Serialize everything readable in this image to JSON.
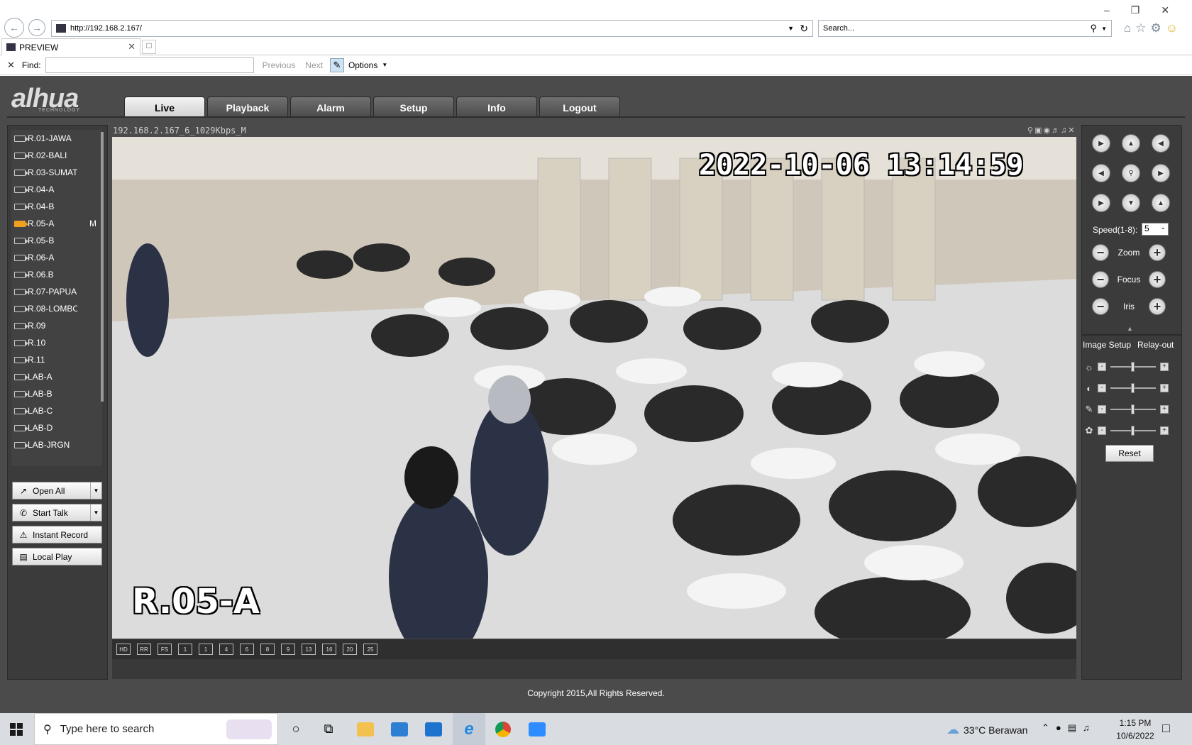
{
  "browser": {
    "url": "http://192.168.2.167/",
    "search_placeholder": "Search...",
    "tab_title": "PREVIEW",
    "find": {
      "label": "Find:",
      "value": "",
      "previous": "Previous",
      "next": "Next",
      "options": "Options"
    }
  },
  "app": {
    "logo": "alhua",
    "logo_sub": "TECHNOLOGY",
    "nav": [
      "Live",
      "Playback",
      "Alarm",
      "Setup",
      "Info",
      "Logout"
    ],
    "active_nav": "Live",
    "cameras": [
      {
        "name": "R.01-JAWA"
      },
      {
        "name": "R.02-BALI"
      },
      {
        "name": "R.03-SUMAT"
      },
      {
        "name": "R.04-A"
      },
      {
        "name": "R.04-B"
      },
      {
        "name": "R.05-A",
        "flag": "M",
        "active": true
      },
      {
        "name": "R.05-B"
      },
      {
        "name": "R.06-A"
      },
      {
        "name": "R.06.B"
      },
      {
        "name": "R.07-PAPUA"
      },
      {
        "name": "R.08-LOMBC"
      },
      {
        "name": "R.09"
      },
      {
        "name": "R.10"
      },
      {
        "name": "R.11"
      },
      {
        "name": "LAB-A"
      },
      {
        "name": "LAB-B"
      },
      {
        "name": "LAB-C"
      },
      {
        "name": "LAB-D"
      },
      {
        "name": "LAB-JRGN"
      }
    ],
    "controls": {
      "open_all": "Open All",
      "start_talk": "Start Talk",
      "instant_record": "Instant Record",
      "local_play": "Local Play"
    },
    "video": {
      "stream_info": "192.168.2.167_6_1029Kbps_M",
      "timestamp": "2022-10-06 13:14:59",
      "camera_label": "R.05-A"
    },
    "layout_buttons": [
      "HD",
      "RR",
      "FS",
      "1",
      "1",
      "4",
      "6",
      "8",
      "9",
      "13",
      "16",
      "20",
      "25"
    ],
    "ptz": {
      "speed_label": "Speed(1-8):",
      "speed_value": "5",
      "zoom": "Zoom",
      "focus": "Focus",
      "iris": "Iris"
    },
    "image_tabs": {
      "image_setup": "Image Setup",
      "relay_out": "Relay-out"
    },
    "image_levels": [
      {
        "icon": "brightness-icon",
        "level": 0.5
      },
      {
        "icon": "contrast-icon",
        "level": 0.5
      },
      {
        "icon": "saturation-icon",
        "level": 0.5
      },
      {
        "icon": "hue-icon",
        "level": 0.5
      }
    ],
    "reset": "Reset",
    "copyright": "Copyright 2015,All Rights Reserved."
  },
  "taskbar": {
    "search_placeholder": "Type here to search",
    "weather": "33°C  Berawan",
    "time": "1:15 PM",
    "date": "10/6/2022"
  }
}
